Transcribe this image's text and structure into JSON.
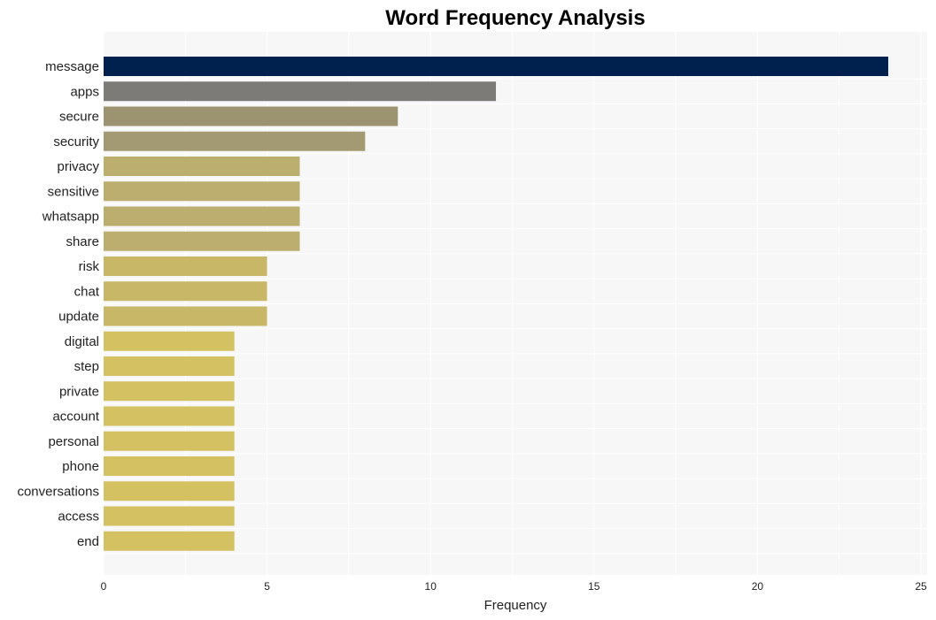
{
  "chart_data": {
    "type": "bar",
    "orientation": "horizontal",
    "title": "Word Frequency Analysis",
    "xlabel": "Frequency",
    "ylabel": "",
    "xlim": [
      0,
      25
    ],
    "xticks": [
      0,
      5,
      10,
      15,
      20,
      25
    ],
    "grid": true,
    "categories": [
      "message",
      "apps",
      "secure",
      "security",
      "privacy",
      "sensitive",
      "whatsapp",
      "share",
      "risk",
      "chat",
      "update",
      "digital",
      "step",
      "private",
      "account",
      "personal",
      "phone",
      "conversations",
      "access",
      "end"
    ],
    "values": [
      24,
      12,
      9,
      8,
      6,
      6,
      6,
      6,
      5,
      5,
      5,
      4,
      4,
      4,
      4,
      4,
      4,
      4,
      4,
      4
    ],
    "colors": [
      "#00204e",
      "#7c7b78",
      "#9c9471",
      "#a39a73",
      "#bbae6e",
      "#bbae6e",
      "#bbae6e",
      "#bbae6e",
      "#c8b767",
      "#c8b767",
      "#c8b767",
      "#d3c162",
      "#d3c162",
      "#d3c162",
      "#d3c162",
      "#d3c162",
      "#d3c162",
      "#d3c162",
      "#d3c162",
      "#d3c162"
    ]
  }
}
